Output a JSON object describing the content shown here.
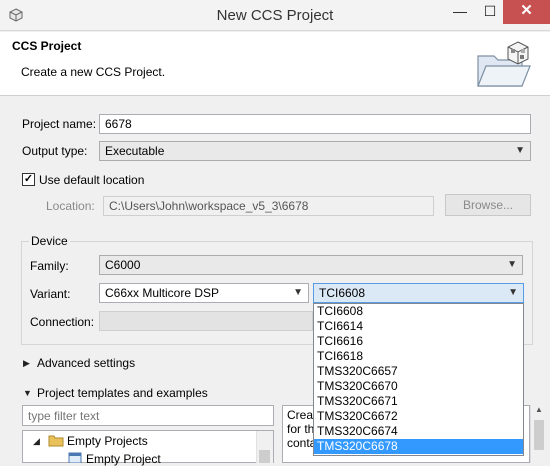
{
  "window": {
    "title": "New CCS Project",
    "minimize_glyph": "—",
    "maximize_glyph": "☐",
    "close_glyph": "✕"
  },
  "header": {
    "title": "CCS Project",
    "description": "Create a new CCS Project."
  },
  "form": {
    "project_name_label": "Project name:",
    "project_name_value": "6678",
    "output_type_label": "Output type:",
    "output_type_value": "Executable",
    "use_default_location_label": "Use default location",
    "use_default_location_checked": true,
    "location_label": "Location:",
    "location_value": "C:\\Users\\John\\workspace_v5_3\\6678",
    "browse_label": "Browse..."
  },
  "device": {
    "group_label": "Device",
    "family_label": "Family:",
    "family_value": "C6000",
    "variant_label": "Variant:",
    "variant_filter_value": "C66xx Multicore DSP",
    "variant_value": "TCI6608",
    "connection_label": "Connection:",
    "variant_options": [
      "TCI6608",
      "TCI6614",
      "TCI6616",
      "TCI6618",
      "TMS320C6657",
      "TMS320C6670",
      "TMS320C6671",
      "TMS320C6672",
      "TMS320C6674",
      "TMS320C6678"
    ],
    "highlighted_option": "TMS320C6678"
  },
  "advanced": {
    "label": "Advanced settings"
  },
  "templates": {
    "label": "Project templates and examples",
    "filter_placeholder": "type filter text",
    "tree_items": [
      "Empty Projects",
      "Empty Project"
    ],
    "description_partial": [
      "Creat",
      "for th",
      "conta"
    ]
  },
  "colors": {
    "close_button": "#c75050",
    "selection": "#3399ff"
  }
}
